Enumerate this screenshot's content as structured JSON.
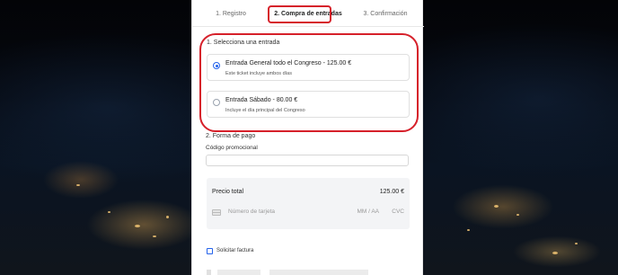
{
  "steps": [
    {
      "label": "1. Registro",
      "active": false
    },
    {
      "label": "2. Compra de entradas",
      "active": true
    },
    {
      "label": "3. Confirmación",
      "active": false
    }
  ],
  "tickets": {
    "section_title": "1. Selecciona una entrada",
    "options": [
      {
        "title": "Entrada General todo el Congreso - 125.00 €",
        "description": "Este ticket incluye ambos días",
        "selected": true
      },
      {
        "title": "Entrada Sábado - 80.00 €",
        "description": "Incluye el día principal del Congreso",
        "selected": false
      }
    ]
  },
  "payment": {
    "section_title": "2. Forma de pago",
    "promo_label": "Código promocional",
    "promo_value": "",
    "total_label": "Precio total",
    "total_amount": "125.00 €",
    "card_number_placeholder": "Número de tarjeta",
    "card_expiry_placeholder": "MM / AA",
    "card_cvc_placeholder": "CVC",
    "invoice_label": "Solicitar factura",
    "invoice_checked": false
  },
  "colors": {
    "highlight": "#d6202a",
    "accent": "#2563eb"
  }
}
